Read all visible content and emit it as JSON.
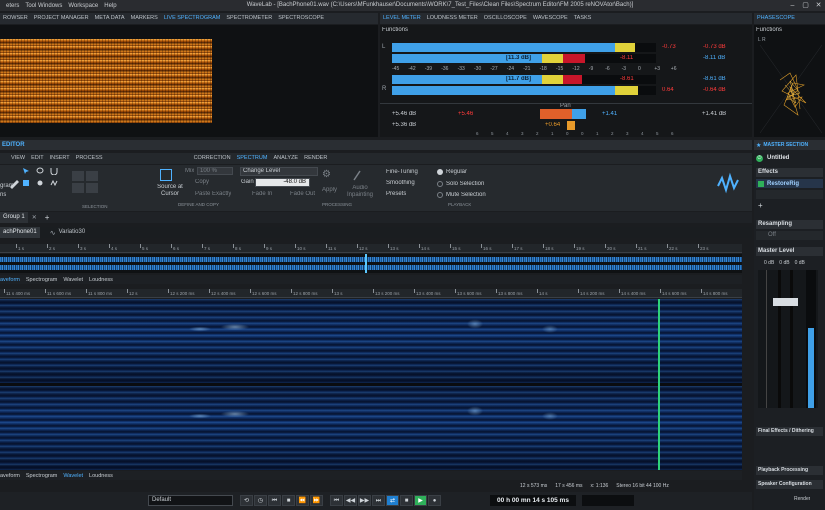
{
  "menu": [
    "eters",
    "Tool Windows",
    "Workspace",
    "Help"
  ],
  "window_title": "WaveLab - [BachPhone01.wav (C:\\Users\\MFunkhauser\\Documents\\WORK\\7_Test_Files\\Clean Files\\Spectrum Editor\\FM 2005 reNOVAtor\\Bach)]",
  "top_tabs": [
    "ROWSER",
    "PROJECT MANAGER",
    "META DATA",
    "MARKERS",
    "LIVE SPECTROGRAM",
    "SPECTROMETER",
    "SPECTROSCOPE"
  ],
  "meter_tabs": [
    "LEVEL METER",
    "LOUDNESS METER",
    "OSCILLOSCOPE",
    "WAVESCOPE",
    "TASKS"
  ],
  "phase_tab": "PHASESCOPE",
  "phase_functions": "Functions",
  "phase_lr": "L R",
  "meter": {
    "functions": "Functions",
    "ch_l": "L",
    "ch_r": "R",
    "peak_l": "-0.73",
    "peak_l_db": "-0.73 dB",
    "rms_l": "[11.3 dB]",
    "rms_l2": "-8.11",
    "rms_l_db": "-8.11 dB",
    "rms_r": "[11.7 dB]",
    "rms_r2": "-8.61",
    "rms_r_db": "-8.61 dB",
    "peak_r": "0.64",
    "peak_r_db": "-0.64 dB",
    "scale": [
      "-45",
      "-42",
      "-39",
      "-36",
      "-33",
      "-30",
      "-27",
      "-24",
      "-21",
      "-18",
      "-15",
      "-12",
      "-9",
      "-6",
      "-3",
      "0",
      "+3",
      "+6"
    ],
    "pan": "Pan",
    "pan_l_db": "+5.46 dB",
    "pan_l_val": "+5.46",
    "pan_l2_db": "+5.36 dB",
    "pan_mid": "+0.64",
    "pan_r_val": "+1.41",
    "pan_r_db": "+1.41 dB",
    "pan_scale": [
      "6",
      "5",
      "4",
      "3",
      "2",
      "1",
      "0",
      "0",
      "1",
      "2",
      "3",
      "4",
      "5",
      "6"
    ],
    "peak_l_level": 0.92,
    "rms_l_level": 0.73,
    "rms_r_level": 0.72,
    "peak_r_level": 0.93
  },
  "editor_label": "EDITOR",
  "editor_tabs": [
    "VIEW",
    "EDIT",
    "INSERT",
    "PROCESS",
    "CORRECTION",
    "SPECTRUM",
    "ANALYZE",
    "RENDER"
  ],
  "ribbon": {
    "left_labels": [
      "gram",
      "ns"
    ],
    "selection_label": "SELECTION",
    "define_copy_label": "DEFINE AND COPY",
    "source_cursor": "Source at Cursor",
    "mix_label": "Mix",
    "mix_value": "100 %",
    "copy_label": "Copy",
    "paste_label": "Paste Exactly",
    "change_level": "Change Level",
    "gain_label": "Gain",
    "gain_value": "-48.0 dB",
    "fade_in": "Fade In",
    "fade_out": "Fade Out",
    "apply": "Apply",
    "processing_label": "PROCESSING",
    "audio_inpainting": "Audio Inpainting",
    "fine_tuning": "Fine-Tuning",
    "smoothing": "Smoothing",
    "presets": "Presets",
    "regular": "Regular",
    "solo_selection": "Solo Selection",
    "mute_selection": "Mute Selection",
    "playback_label": "PLAYBACK"
  },
  "group_tab": "Group 1",
  "file_tabs": [
    "achPhone01",
    "Variatio30"
  ],
  "overview_ruler": [
    "1 s",
    "2 s",
    "3 s",
    "4 s",
    "5 s",
    "6 s",
    "7 s",
    "8 s",
    "9 s",
    "10 s",
    "11 s",
    "12 s",
    "13 s",
    "14 s",
    "15 s",
    "16 s",
    "17 s",
    "18 s",
    "19 s",
    "20 s",
    "21 s",
    "22 s",
    "23 s"
  ],
  "view_tabs": [
    "aveform",
    "Spectrogram",
    "Wavelet",
    "Loudness"
  ],
  "main_ruler": [
    "11 s 400 ms",
    "11 s 600 ms",
    "11 s 800 ms",
    "12 s",
    "12 s 200 ms",
    "12 s 400 ms",
    "12 s 600 ms",
    "12 s 800 ms",
    "13 s",
    "13 s 200 ms",
    "13 s 400 ms",
    "13 s 600 ms",
    "13 s 800 ms",
    "14 s",
    "14 s 200 ms",
    "14 s 400 ms",
    "14 s 600 ms",
    "14 s 800 ms"
  ],
  "bottom_view_tabs": [
    "aveform",
    "Spectrogram",
    "Wavelet",
    "Loudness"
  ],
  "status": {
    "sel_start": "12 s 573 ms",
    "sel_len": "17 s 456 ms",
    "zoom": "x: 1:136",
    "format": "Stereo 16 bit 44 100 Hz"
  },
  "transport": {
    "preset": "Default",
    "time": "00 h 00 mn 14 s 105 ms"
  },
  "master": {
    "title": "MASTER SECTION",
    "untitled": "Untitled",
    "effects": "Effects",
    "restore": "RestoreRig",
    "resampling": "Resampling",
    "off": "Off",
    "master_level": "Master Level",
    "db_l": "0 dB",
    "db_m": "0 dB",
    "db_r": "0 dB",
    "final_effects": "Final Effects / Dithering",
    "playback_processing": "Playback Processing",
    "speaker_config": "Speaker Configuration",
    "render": "Render",
    "level_fill": 0.58
  },
  "colors": {
    "accent": "#4fb2ff",
    "meter_blue": "#3fa0e8",
    "meter_yellow": "#e0d23a",
    "meter_red": "#c8162a",
    "playhead": "#2fd27a",
    "peak_red_text": "#ff3b3b"
  },
  "icons": [
    "chevron-down-icon",
    "gear-icon",
    "cursor-icon",
    "lasso-icon",
    "play-icon",
    "stop-icon",
    "record-icon",
    "loop-icon",
    "wave-logo-icon",
    "close-icon",
    "power-icon"
  ]
}
